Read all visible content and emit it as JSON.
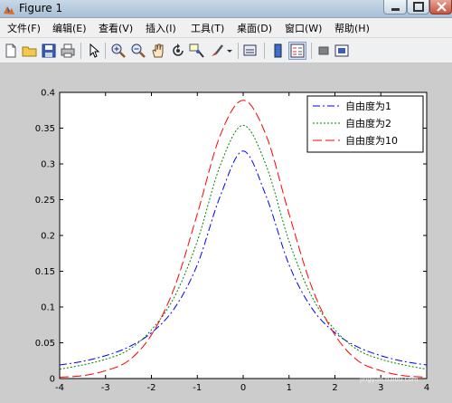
{
  "window": {
    "title": "Figure 1",
    "title_colors": {
      "accent": "#a7bfd6"
    }
  },
  "menu": {
    "items": [
      {
        "label": "文件(F)"
      },
      {
        "label": "编辑(E)"
      },
      {
        "label": "查看(V)"
      },
      {
        "label": "插入(I)"
      },
      {
        "label": "工具(T)"
      },
      {
        "label": "桌面(D)"
      },
      {
        "label": "窗口(W)"
      },
      {
        "label": "帮助(H)"
      }
    ]
  },
  "toolbar": {
    "icons": [
      "new-figure-icon",
      "open-file-icon",
      "save-icon",
      "print-icon",
      "edit-plot-arrow-icon",
      "zoom-in-icon",
      "zoom-out-icon",
      "pan-hand-icon",
      "rotate-3d-icon",
      "data-cursor-icon",
      "brush-icon",
      "link-plot-icon",
      "colorbar-icon",
      "legend-icon",
      "hide-plot-tools-icon",
      "show-plot-tools-icon"
    ]
  },
  "watermark": {
    "text": "Bai",
    "url": "jingyan.baidu.com"
  },
  "chart_data": {
    "type": "line",
    "title": "",
    "xlabel": "",
    "ylabel": "",
    "xlim": [
      -4,
      4
    ],
    "ylim": [
      0,
      0.4
    ],
    "x_ticks": [
      -4,
      -3,
      -2,
      -1,
      0,
      1,
      2,
      3,
      4
    ],
    "y_ticks": [
      0,
      0.05,
      0.1,
      0.15,
      0.2,
      0.25,
      0.3,
      0.35,
      0.4
    ],
    "x_tick_labels": [
      "-4",
      "-3",
      "-2",
      "-1",
      "0",
      "1",
      "2",
      "3",
      "4"
    ],
    "y_tick_labels": [
      "0",
      "0.05",
      "0.1",
      "0.15",
      "0.2",
      "0.25",
      "0.3",
      "0.35",
      "0.4"
    ],
    "grid": false,
    "legend_position": "top-right",
    "x": [
      -4,
      -3.5,
      -3,
      -2.5,
      -2,
      -1.5,
      -1,
      -0.5,
      0,
      0.5,
      1,
      1.5,
      2,
      2.5,
      3,
      3.5,
      4
    ],
    "series": [
      {
        "name": "自由度为1",
        "color": "#0000ff",
        "style": "dashdot",
        "values": [
          0.019,
          0.024,
          0.032,
          0.044,
          0.064,
          0.098,
          0.159,
          0.255,
          0.318,
          0.255,
          0.159,
          0.098,
          0.064,
          0.044,
          0.032,
          0.024,
          0.019
        ]
      },
      {
        "name": "自由度为2",
        "color": "#008000",
        "style": "dotted",
        "values": [
          0.013,
          0.019,
          0.027,
          0.04,
          0.068,
          0.114,
          0.192,
          0.298,
          0.354,
          0.298,
          0.192,
          0.114,
          0.068,
          0.04,
          0.027,
          0.019,
          0.013
        ]
      },
      {
        "name": "自由度为10",
        "color": "#ff0000",
        "style": "dashed",
        "values": [
          0.002,
          0.004,
          0.011,
          0.025,
          0.061,
          0.127,
          0.23,
          0.34,
          0.389,
          0.34,
          0.23,
          0.127,
          0.061,
          0.025,
          0.011,
          0.004,
          0.002
        ]
      }
    ]
  }
}
